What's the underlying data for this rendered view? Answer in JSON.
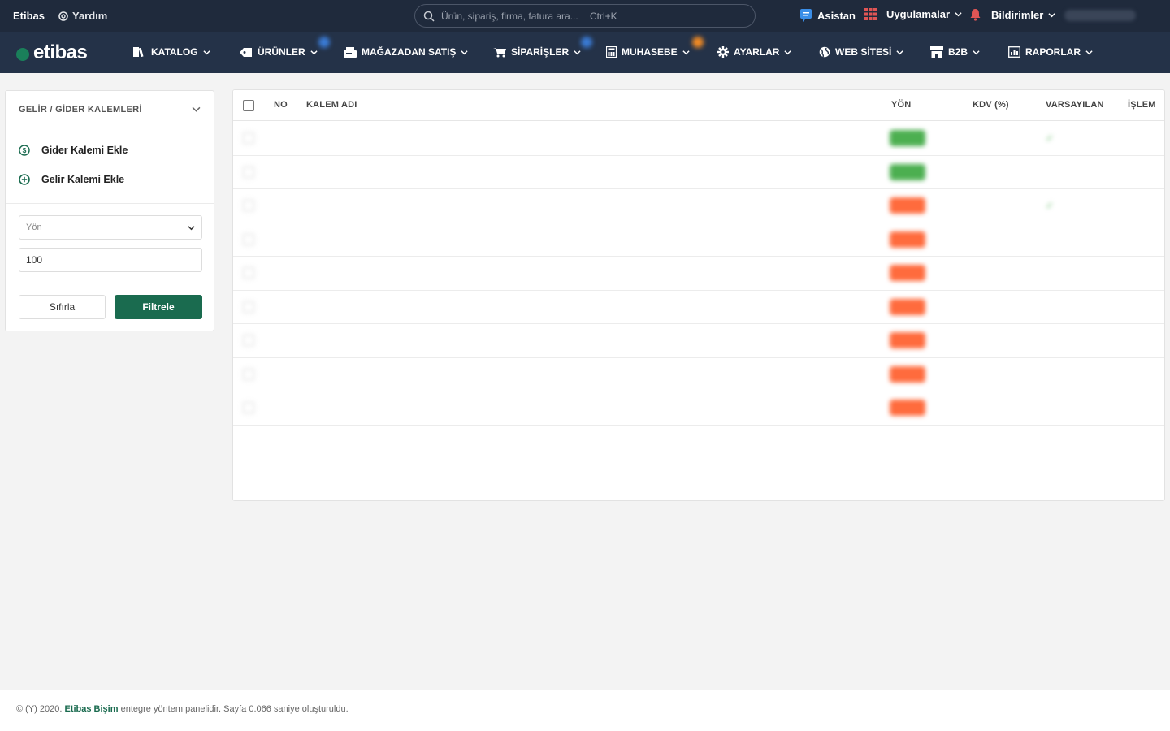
{
  "topbar": {
    "brand": "Etibas",
    "help": "Yardım",
    "search_placeholder": "Ürün, sipariş, firma, fatura ara...",
    "search_shortcut": "Ctrl+K",
    "assistant": "Asistan",
    "apps": "Uygulamalar",
    "notifications": "Bildirimler"
  },
  "nav": {
    "logo": "etibas",
    "items": [
      {
        "label": "KATALOG",
        "icon": "books-icon"
      },
      {
        "label": "ÜRÜNLER",
        "icon": "tag-icon"
      },
      {
        "label": "MAĞAZADAN SATIŞ",
        "icon": "register-icon"
      },
      {
        "label": "SİPARİŞLER",
        "icon": "cart-icon"
      },
      {
        "label": "MUHASEBE",
        "icon": "calculator-icon"
      },
      {
        "label": "AYARLAR",
        "icon": "gear-icon"
      },
      {
        "label": "WEB SİTESİ",
        "icon": "globe-icon"
      },
      {
        "label": "B2B",
        "icon": "store-icon"
      },
      {
        "label": "RAPORLAR",
        "icon": "report-icon"
      }
    ]
  },
  "sidebar": {
    "title": "GELİR / GİDER KALEMLERİ",
    "add_expense": "Gider Kalemi Ekle",
    "add_income": "Gelir Kalemi Ekle",
    "direction_placeholder": "Yön",
    "limit_value": "100",
    "reset_label": "Sıfırla",
    "filter_label": "Filtrele"
  },
  "table": {
    "headers": {
      "no": "NO",
      "name": "KALEM ADI",
      "direction": "YÖN",
      "vat": "KDV (%)",
      "default": "VARSAYILAN",
      "action": "İŞLEM"
    }
  },
  "colors": {
    "topbar": "#1f2a3c",
    "navbar": "#243248",
    "accent": "#1a6b4f",
    "income": "#4caf50",
    "expense": "#ff6b3d"
  },
  "footer": {
    "prefix": "© (Y) 2020.",
    "company": "Etibas Bişim",
    "suffix": "entegre yöntem panelidir. Sayfa 0.066 saniye oluşturuldu."
  }
}
